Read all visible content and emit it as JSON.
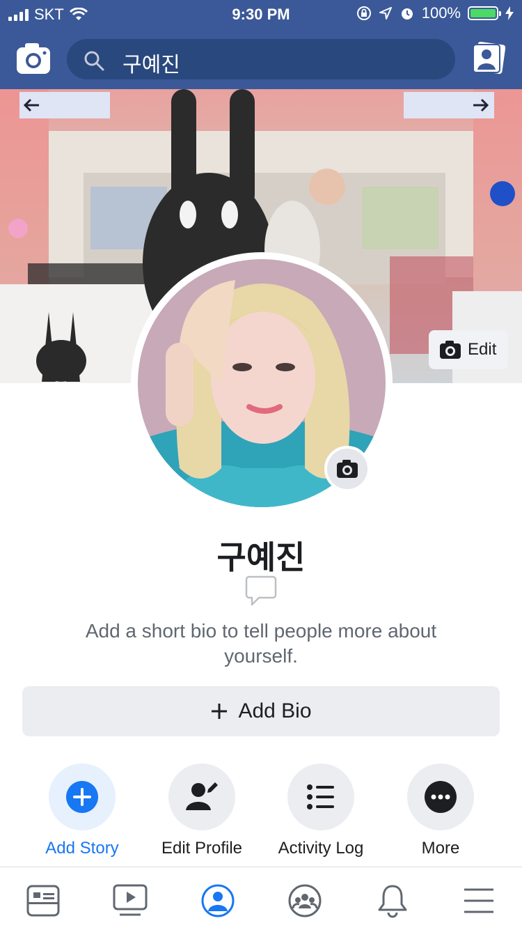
{
  "status_bar": {
    "carrier": "SKT",
    "time": "9:30 PM",
    "battery": "100%"
  },
  "search": {
    "value": "구예진"
  },
  "cover": {
    "edit_label": "Edit"
  },
  "profile": {
    "name": "구예진",
    "bio_prompt": "Add a short bio to tell people more about yourself.",
    "add_bio_label": "Add Bio"
  },
  "actions": [
    {
      "label": "Add Story",
      "icon": "plus-icon"
    },
    {
      "label": "Edit Profile",
      "icon": "person-edit-icon"
    },
    {
      "label": "Activity Log",
      "icon": "list-icon"
    },
    {
      "label": "More",
      "icon": "more-icon"
    }
  ],
  "tabbar": [
    {
      "icon": "news-feed-icon"
    },
    {
      "icon": "watch-icon"
    },
    {
      "icon": "profile-icon",
      "active": true
    },
    {
      "icon": "groups-icon"
    },
    {
      "icon": "notifications-icon"
    },
    {
      "icon": "menu-icon"
    }
  ],
  "colors": {
    "header": "#3b5998",
    "accent": "#1877f2"
  }
}
